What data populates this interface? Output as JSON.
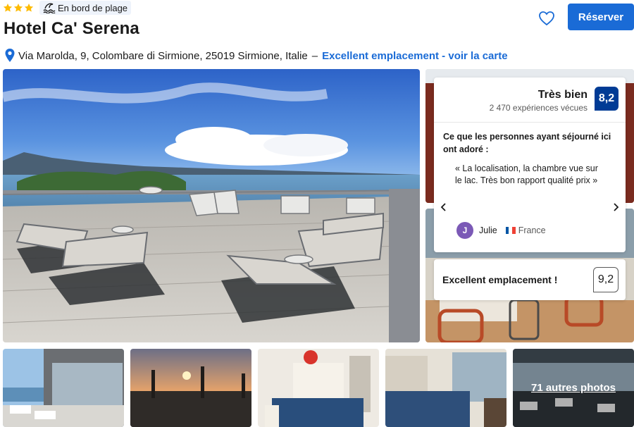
{
  "header": {
    "star_count": 3,
    "star_color": "#febb02",
    "beach_icon": "beach-wave-icon",
    "beach_label": "En bord de plage",
    "hotel_name": "Hotel Ca' Serena",
    "save_icon": "heart-icon",
    "book_label": "Réserver"
  },
  "location": {
    "pin_icon": "map-pin-icon",
    "address": "Via Marolda, 9, Colombare di Sirmione, 25019 Sirmione, Italie",
    "separator": "–",
    "map_link": "Excellent emplacement - voir la carte"
  },
  "review_card": {
    "rating_word": "Très bien",
    "review_count": "2 470 expériences vécues",
    "score": "8,2",
    "loved_heading": "Ce que les personnes ayant séjourné ici ont adoré :",
    "quote": "« La localisation, la chambre vue sur le lac. Très bon rapport qualité prix »",
    "reviewer_initial": "J",
    "reviewer_name": "Julie",
    "reviewer_country": "France",
    "prev_icon": "chevron-left-icon",
    "next_icon": "chevron-right-icon"
  },
  "location_card": {
    "label": "Excellent emplacement !",
    "score": "9,2"
  },
  "gallery": {
    "more_photos": "71 autres photos"
  },
  "colors": {
    "brand_blue": "#1a6bd6",
    "score_navy": "#003b95",
    "avatar_purple": "#7b59b6"
  }
}
